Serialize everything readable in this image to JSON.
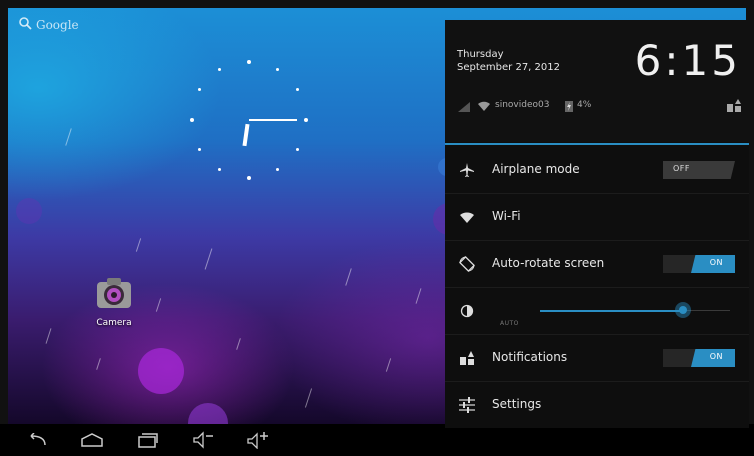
{
  "search": {
    "label": "Google"
  },
  "desktop": {
    "camera_label": "Camera"
  },
  "panel": {
    "day": "Thursday",
    "date": "September 27, 2012",
    "time": "6:15",
    "network_name": "sinovideo03",
    "battery": "4%",
    "rows": {
      "airplane": {
        "label": "Airplane mode",
        "state": "OFF"
      },
      "wifi": {
        "label": "Wi-Fi"
      },
      "autorotate": {
        "label": "Auto-rotate screen",
        "state": "ON"
      },
      "brightness": {
        "auto_label": "AUTO",
        "level": 0.75
      },
      "notifications": {
        "label": "Notifications",
        "state": "ON"
      },
      "settings": {
        "label": "Settings"
      }
    }
  },
  "colors": {
    "accent": "#2a8ec3",
    "panel_bg": "#0e0e0e",
    "toggle_off": "#3a3a3a"
  },
  "icons": {
    "search": "search-icon",
    "airplane": "airplane-icon",
    "wifi": "wifi-icon",
    "rotate": "auto-rotate-icon",
    "brightness": "brightness-icon",
    "notifications": "notifications-icon",
    "settings": "settings-sliders-icon",
    "back": "back-icon",
    "home": "home-icon",
    "recents": "recent-apps-icon",
    "vol_down": "volume-down-icon",
    "vol_up": "volume-up-icon"
  }
}
